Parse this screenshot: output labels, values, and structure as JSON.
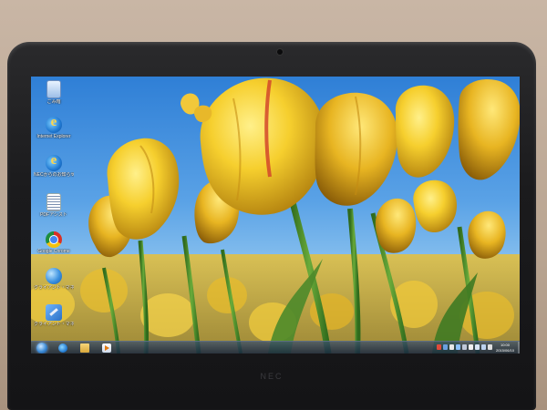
{
  "bezel": {
    "brand": "NEC"
  },
  "desktop": {
    "icons": [
      {
        "name": "recycle-bin-icon",
        "label": "ごみ箱",
        "glyph": "recycle"
      },
      {
        "name": "internet-explorer-icon",
        "label": "Internet Explorer",
        "glyph": "ie"
      },
      {
        "name": "nec-info-icon",
        "label": "NECからのお知らせ",
        "glyph": "ie"
      },
      {
        "name": "document-icon",
        "label": "PDFアシスト",
        "glyph": "doc"
      },
      {
        "name": "chrome-icon",
        "label": "Google Chrome",
        "glyph": "chrome"
      },
      {
        "name": "globe-icon",
        "label": "クライアント・マネージャ",
        "glyph": "globe"
      },
      {
        "name": "tool-icon",
        "label": "クライアント・マネージャ操作ツール",
        "glyph": "tool"
      }
    ]
  },
  "taskbar": {
    "pinned": [
      {
        "name": "taskbar-internet-explorer-icon",
        "kind": "ie"
      },
      {
        "name": "taskbar-folder-icon",
        "kind": "folder"
      },
      {
        "name": "taskbar-media-player-icon",
        "kind": "media"
      }
    ],
    "clock": {
      "time": "10:00",
      "date": "2015/06/10"
    }
  },
  "colors": {
    "sky": "#5aa2e6",
    "tulip": "#f3c531",
    "stem": "#4f8f2c",
    "bezel": "#1b1b1d"
  }
}
